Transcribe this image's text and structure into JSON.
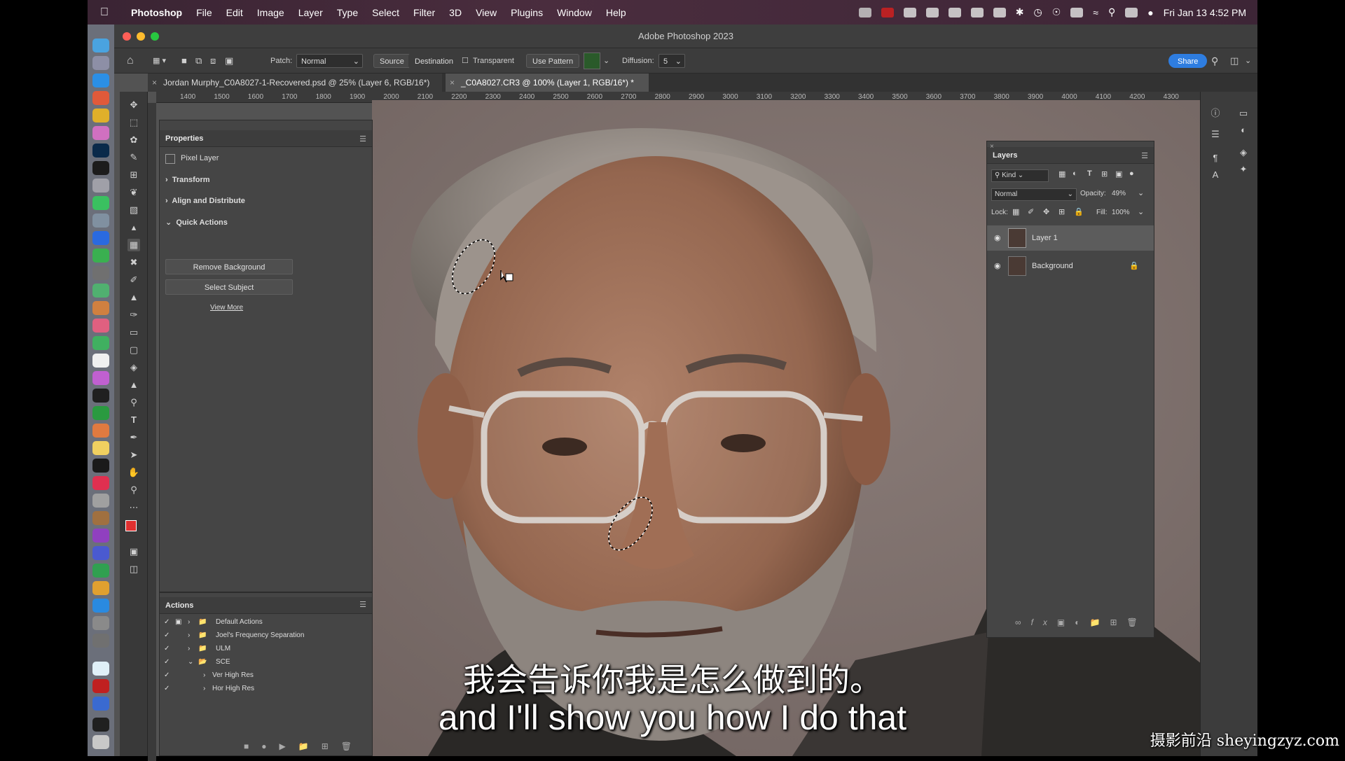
{
  "menubar": {
    "app_name": "Photoshop",
    "items": [
      "File",
      "Edit",
      "Image",
      "Layer",
      "Type",
      "Select",
      "Filter",
      "3D",
      "View",
      "Plugins",
      "Window",
      "Help"
    ],
    "datetime": "Fri Jan 13  4:52 PM"
  },
  "window": {
    "title": "Adobe Photoshop 2023"
  },
  "options_bar": {
    "patch_label": "Patch:",
    "patch_mode": "Normal",
    "source_label": "Source",
    "destination_label": "Destination",
    "transparent_label": "Transparent",
    "use_pattern_label": "Use Pattern",
    "diffusion_label": "Diffusion:",
    "diffusion_value": "5",
    "share_label": "Share"
  },
  "tabs": [
    {
      "label": "Jordan Murphy_C0A8027-1-Recovered.psd @ 25% (Layer 6, RGB/16*) *"
    },
    {
      "label": "_C0A8027.CR3 @ 100% (Layer 1, RGB/16*) *"
    }
  ],
  "ruler": {
    "ticks": [
      "1400",
      "1500",
      "1600",
      "1700",
      "1800",
      "1900",
      "2000",
      "2100",
      "2200",
      "2300",
      "2400",
      "2500",
      "2600",
      "2700",
      "2800",
      "2900",
      "3000",
      "3100",
      "3200",
      "3300",
      "3400",
      "3500",
      "3600",
      "3700",
      "3800",
      "3900",
      "4000",
      "4100",
      "4200",
      "4300"
    ]
  },
  "properties": {
    "title": "Properties",
    "layer_type": "Pixel Layer",
    "sections": [
      "Transform",
      "Align and Distribute",
      "Quick Actions"
    ],
    "buttons": [
      "Remove Background",
      "Select Subject"
    ],
    "view_more": "View More"
  },
  "actions": {
    "title": "Actions",
    "rows": [
      "Default Actions",
      "Joel's Frequency Separation",
      "ULM",
      "SCE",
      "Ver High Res",
      "Hor High Res"
    ]
  },
  "layers": {
    "title": "Layers",
    "filter_kind": "Kind",
    "blend_mode": "Normal",
    "opacity_label": "Opacity:",
    "opacity_value": "49%",
    "lock_label": "Lock:",
    "fill_label": "Fill:",
    "fill_value": "100%",
    "items": [
      {
        "name": "Layer 1"
      },
      {
        "name": "Background"
      }
    ]
  },
  "subtitles": {
    "chinese": "我会告诉你我是怎么做到的。",
    "english": "and I'll show you how I do that"
  },
  "watermark": "摄影前沿 sheyingzyz.com",
  "colors": {
    "accent": "#2e7de0",
    "foreground_swatch": "#e03030",
    "background_swatch": "#ffffff"
  }
}
